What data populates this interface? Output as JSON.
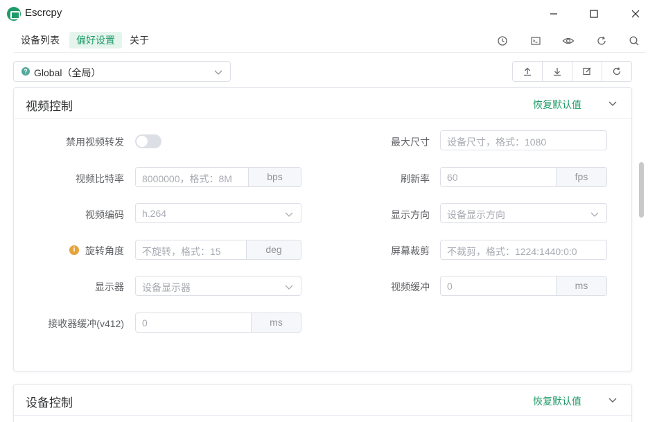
{
  "window": {
    "title": "Escrcpy"
  },
  "nav": {
    "tabs": [
      {
        "label": "设备列表",
        "active": false
      },
      {
        "label": "偏好设置",
        "active": true
      },
      {
        "label": "关于",
        "active": false
      }
    ],
    "toolbar_icons": [
      "history-icon",
      "terminal-icon",
      "eye-icon",
      "refresh-icon",
      "search-icon"
    ]
  },
  "scope": {
    "selected": "Global（全局）",
    "status_glyph": "?"
  },
  "actions": {
    "icons": [
      "upload-icon",
      "download-icon",
      "edit-icon",
      "reset-icon"
    ]
  },
  "colors": {
    "accent": "#1f9b68",
    "tab_active_bg": "#e6f4ee",
    "info": "#e6a23c"
  },
  "video_panel": {
    "title": "视频控制",
    "restore_label": "恢复默认值",
    "fields": {
      "disable_forward": {
        "label": "禁用视频转发",
        "enabled": false
      },
      "bitrate": {
        "label": "视频比特率",
        "placeholder": "8000000，格式：8M",
        "suffix": "bps"
      },
      "encoder": {
        "label": "视频编码",
        "value": "h.264"
      },
      "rotation": {
        "label": "旋转角度",
        "placeholder": "不旋转，格式：15",
        "suffix": "deg",
        "info_glyph": "i"
      },
      "display": {
        "label": "显示器",
        "placeholder": "设备显示器"
      },
      "receiver_buffer": {
        "label": "接收器缓冲(v412)",
        "value": "0",
        "suffix": "ms"
      },
      "max_size": {
        "label": "最大尺寸",
        "placeholder": "设备尺寸，格式：1080"
      },
      "refresh_rate": {
        "label": "刷新率",
        "value": "60",
        "suffix": "fps"
      },
      "orientation": {
        "label": "显示方向",
        "placeholder": "设备显示方向"
      },
      "crop": {
        "label": "屏幕裁剪",
        "placeholder": "不裁剪，格式：1224:1440:0:0"
      },
      "video_buffer": {
        "label": "视频缓冲",
        "value": "0",
        "suffix": "ms"
      }
    }
  },
  "device_panel": {
    "title": "设备控制",
    "restore_label": "恢复默认值"
  }
}
